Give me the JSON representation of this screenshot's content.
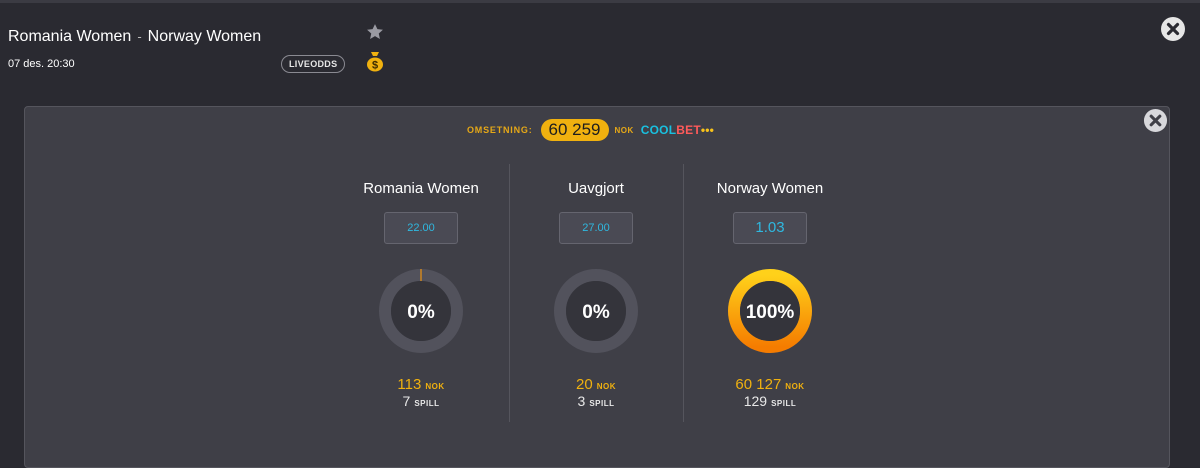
{
  "match": {
    "home": "Romania Women",
    "separator": "-",
    "away": "Norway Women",
    "date": "07 des. 20:30",
    "liveodds_label": "LIVEODDS"
  },
  "icons": {
    "favorite": "star-icon",
    "betting": "money-bag-icon",
    "close": "close-icon"
  },
  "turnover": {
    "label": "OMSETNING:",
    "value": "60 259",
    "currency": "NOK",
    "brand": [
      "COOL",
      "BET",
      "•••"
    ]
  },
  "outcomes": [
    {
      "name": "Romania Women",
      "odds": "22.00",
      "percent_label": "0%",
      "percent": 0,
      "amount": "113",
      "amount_unit": "NOK",
      "games": "7",
      "games_unit": "SPILL"
    },
    {
      "name": "Uavgjort",
      "odds": "27.00",
      "percent_label": "0%",
      "percent": 0,
      "amount": "20",
      "amount_unit": "NOK",
      "games": "3",
      "games_unit": "SPILL"
    },
    {
      "name": "Norway Women",
      "odds": "1.03",
      "percent_label": "100%",
      "percent": 100,
      "amount": "60 127",
      "amount_unit": "NOK",
      "games": "129",
      "games_unit": "SPILL"
    }
  ],
  "colors": {
    "background": "#2a2a31",
    "panel": "#3f3f47",
    "accent_gold": "#f0b10f",
    "odds_text": "#2fb8e0",
    "ring_track": "#52525c",
    "ring_inner": "#34343b"
  }
}
